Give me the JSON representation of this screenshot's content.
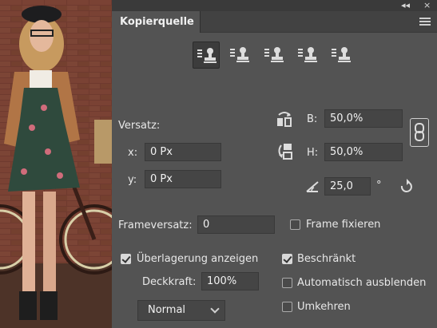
{
  "panel": {
    "title": "Kopierquelle",
    "topbar": {
      "collapse": "◂◂",
      "close": "×"
    },
    "source_buttons": [
      "clone-source-1",
      "clone-source-2",
      "clone-source-3",
      "clone-source-4",
      "clone-source-5"
    ],
    "offset": {
      "label": "Versatz:",
      "x_label": "x:",
      "x_value": "0 Px",
      "y_label": "y:",
      "y_value": "0 Px"
    },
    "scale": {
      "w_label": "B:",
      "w_value": "50,0%",
      "h_label": "H:",
      "h_value": "50,0%"
    },
    "angle": {
      "value": "25,0",
      "unit": "°"
    },
    "frame": {
      "offset_label": "Frameversatz:",
      "offset_value": "0",
      "lock_label": "Frame fixieren",
      "lock_checked": false
    },
    "overlay": {
      "show_label": "Überlagerung anzeigen",
      "show_checked": true,
      "opacity_label": "Deckkraft:",
      "opacity_value": "100%",
      "blend_mode": "Normal",
      "clipped_label": "Beschränkt",
      "clipped_checked": true,
      "autohide_label": "Automatisch ausblenden",
      "autohide_checked": false,
      "invert_label": "Umkehren",
      "invert_checked": false
    }
  },
  "colors": {
    "panel_bg": "#535353",
    "field_bg": "#454545",
    "text": "#e8e8e8"
  }
}
